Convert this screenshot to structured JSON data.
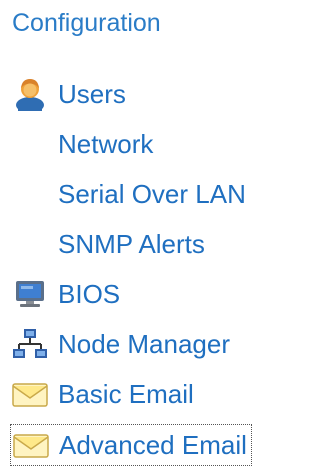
{
  "nav": {
    "title": "Configuration",
    "items": [
      {
        "label": "Users",
        "icon": "user-icon"
      },
      {
        "label": "Network",
        "icon": ""
      },
      {
        "label": "Serial Over LAN",
        "icon": ""
      },
      {
        "label": "SNMP Alerts",
        "icon": ""
      },
      {
        "label": "BIOS",
        "icon": "monitor-icon"
      },
      {
        "label": "Node Manager",
        "icon": "network-nodes-icon"
      },
      {
        "label": "Basic Email",
        "icon": "envelope-icon"
      },
      {
        "label": "Advanced Email",
        "icon": "envelope-icon",
        "selected": true
      }
    ]
  },
  "colors": {
    "title": "#2a7cc7",
    "link": "#1f6fc0"
  }
}
